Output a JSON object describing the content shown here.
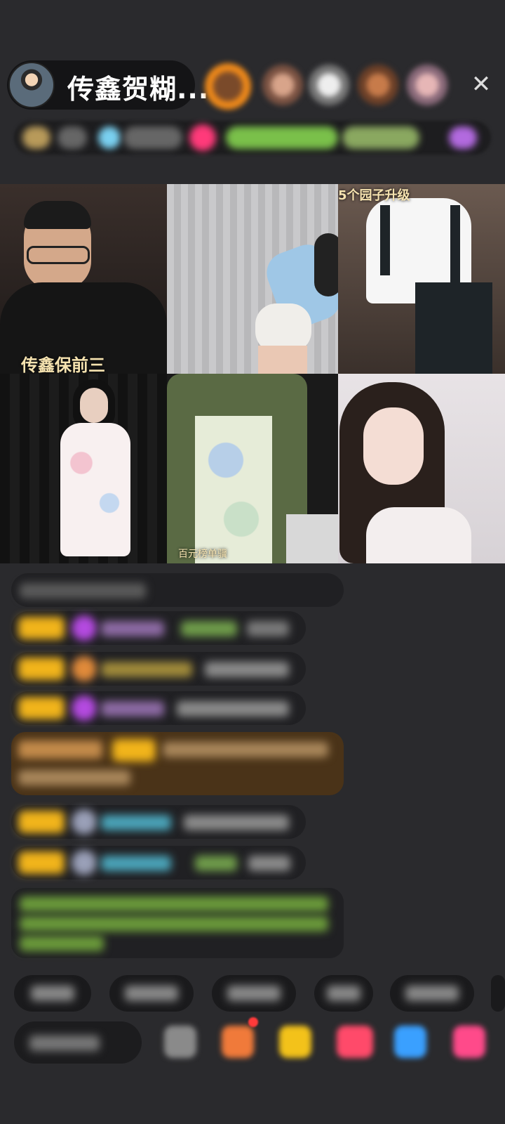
{
  "header": {
    "host_name": "传鑫贺糊..."
  },
  "tiles": {
    "t1_label": "传鑫保前三",
    "t3_label": "5个园子升级",
    "t5_label": "百元榜单骥"
  },
  "colors": {
    "background": "#2a2a2d",
    "pill": "#141416",
    "gold_badge": "#f1b41b",
    "system_message_bg": "#4a3318",
    "green_text": "#8bcc4a"
  },
  "icons": {
    "close": "close-icon",
    "gift": "gift-icon",
    "emoji": "emoji-icon"
  }
}
